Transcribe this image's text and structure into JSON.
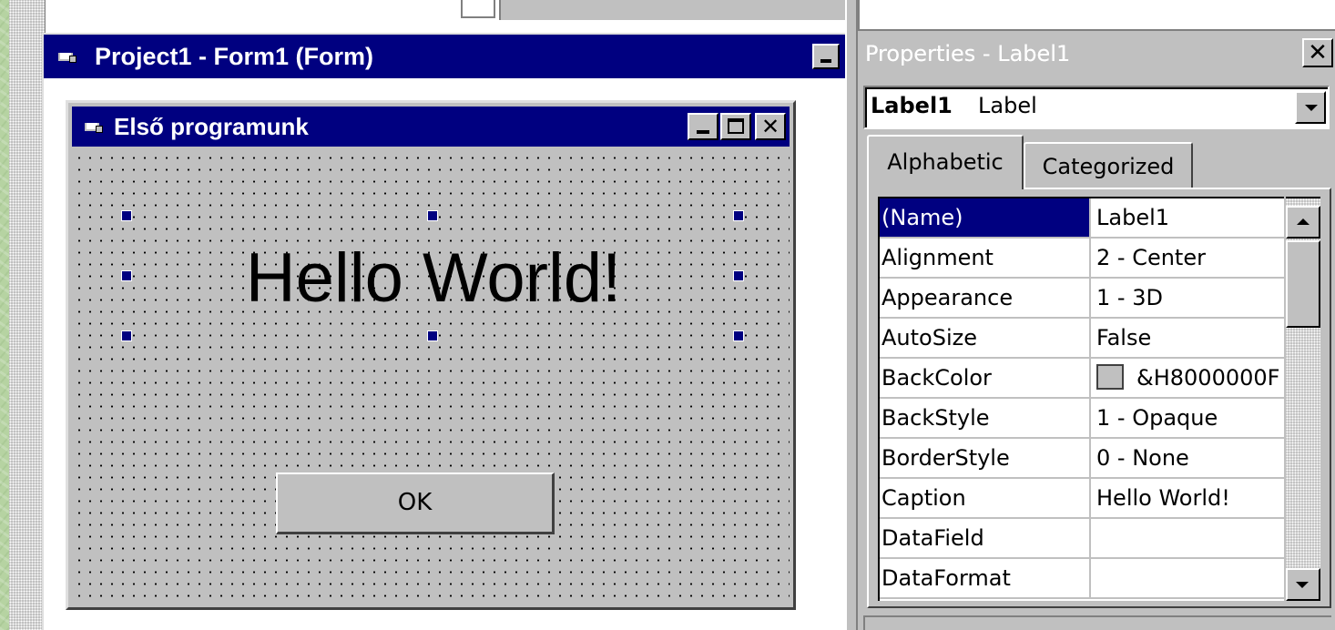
{
  "designer_window": {
    "title": "Project1 - Form1 (Form)"
  },
  "form1": {
    "title": "Első programunk",
    "label_caption": "Hello World!",
    "button_caption": "OK"
  },
  "properties_window": {
    "title": "Properties - Label1",
    "close_glyph": "✕",
    "object_name": "Label1",
    "object_type": "Label",
    "tabs": [
      {
        "label": "Alphabetic",
        "active": true
      },
      {
        "label": "Categorized",
        "active": false
      }
    ],
    "rows": [
      {
        "name": "(Name)",
        "value": "Label1",
        "selected": true
      },
      {
        "name": "Alignment",
        "value": "2 - Center"
      },
      {
        "name": "Appearance",
        "value": "1 - 3D"
      },
      {
        "name": "AutoSize",
        "value": "False"
      },
      {
        "name": "BackColor",
        "value": "&H8000000F",
        "swatch_color": "#c0c0c0"
      },
      {
        "name": "BackStyle",
        "value": "1 - Opaque"
      },
      {
        "name": "BorderStyle",
        "value": "0 - None"
      },
      {
        "name": "Caption",
        "value": "Hello World!"
      },
      {
        "name": "DataField",
        "value": ""
      },
      {
        "name": "DataFormat",
        "value": ""
      }
    ]
  },
  "colors": {
    "titlebar_active": "#000080",
    "face": "#c0c0c0",
    "selection": "#000080",
    "background": "#b6d3a2"
  },
  "icons": [
    "form-icon",
    "minimize-icon",
    "maximize-icon",
    "close-icon",
    "dropdown-arrow-icon",
    "scroll-up-icon",
    "scroll-down-icon"
  ]
}
